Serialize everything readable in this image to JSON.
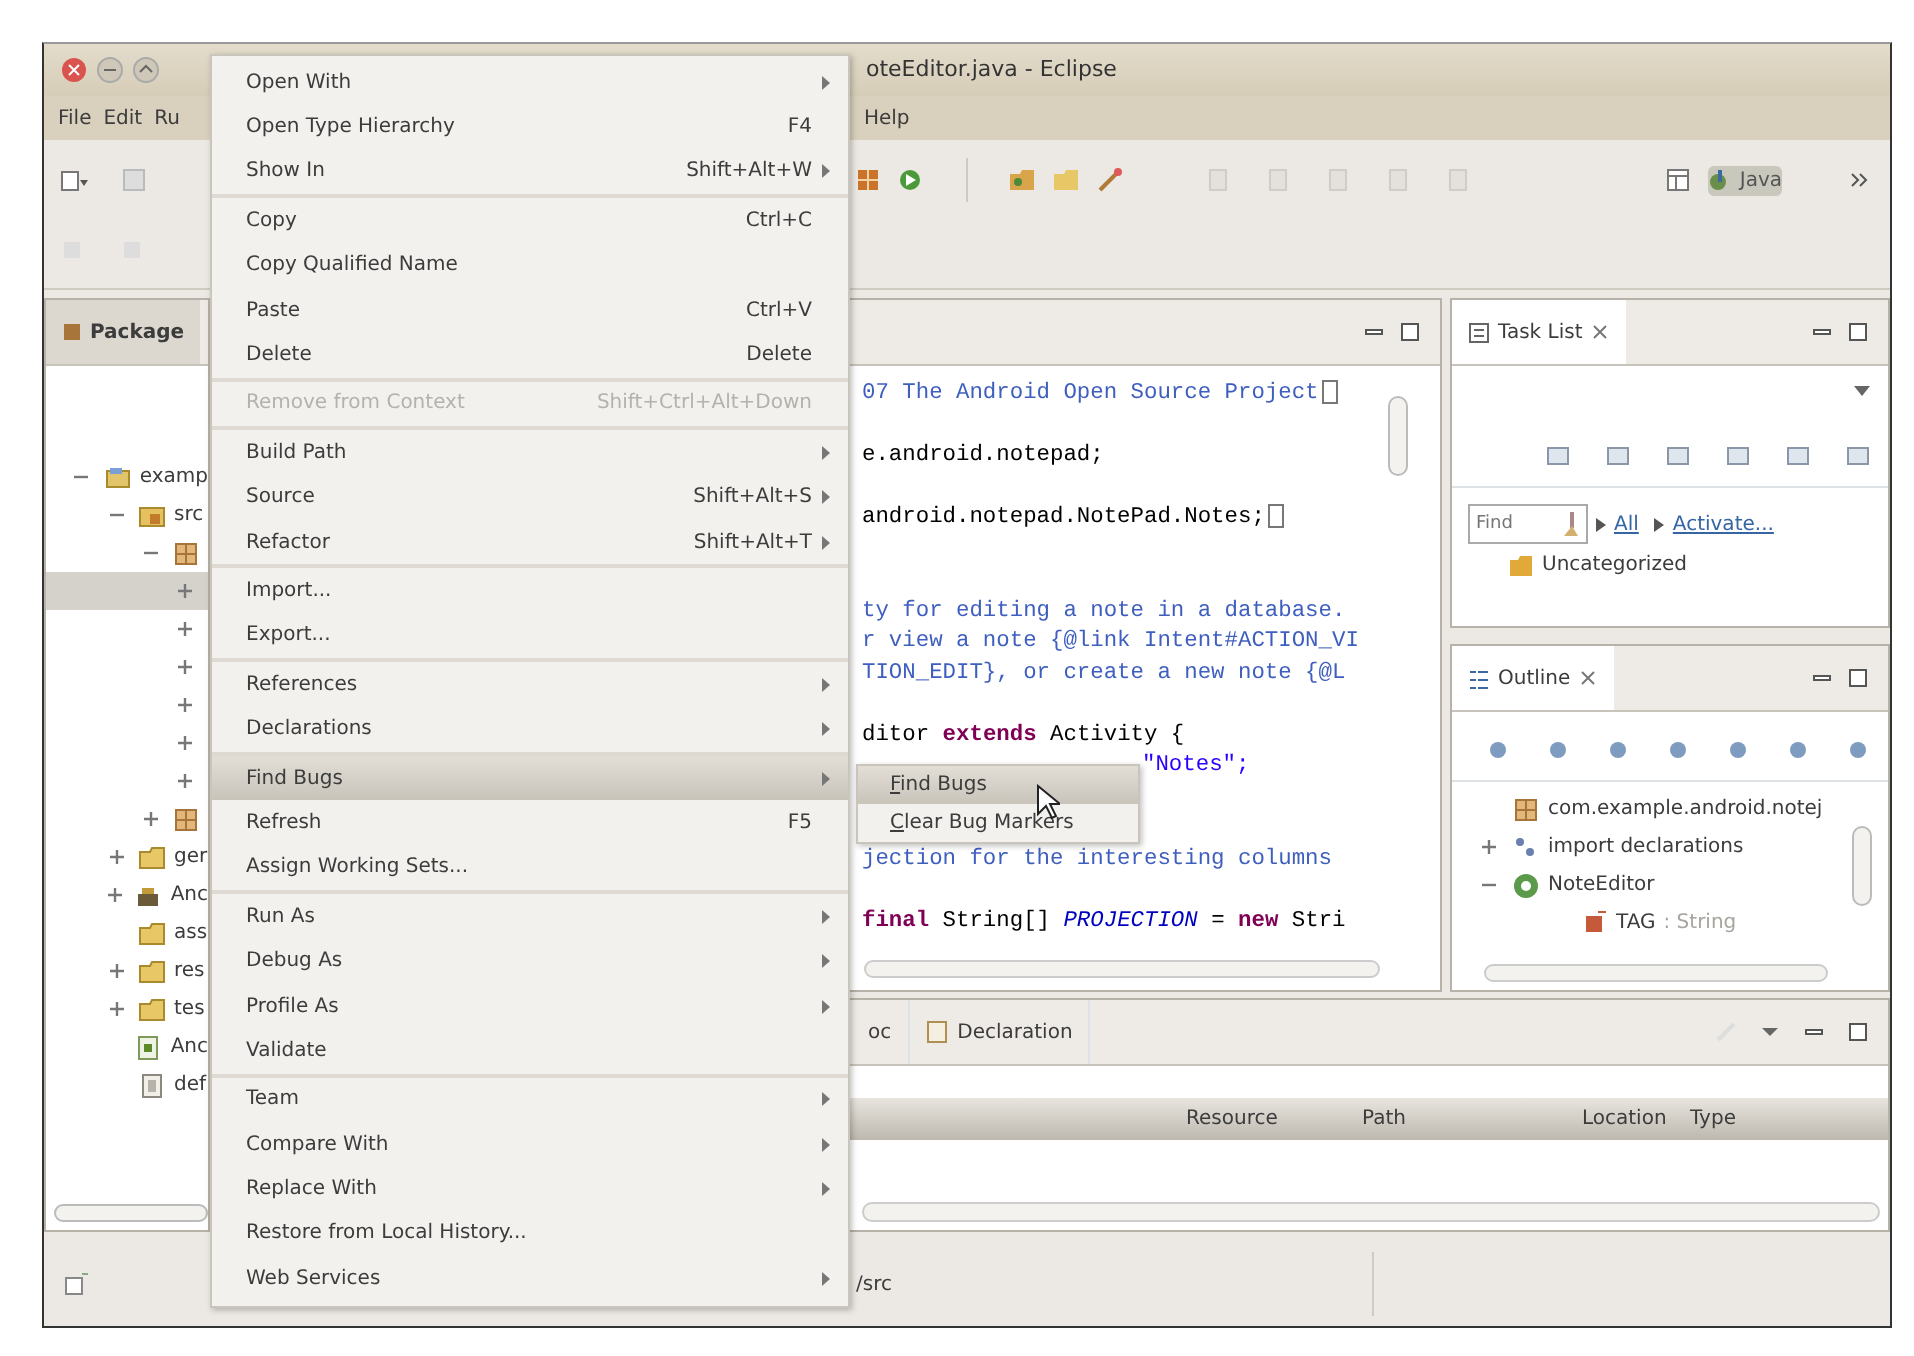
{
  "window": {
    "title": "oteEditor.java - Eclipse"
  },
  "menu_bar": {
    "left_items": [
      "File",
      "Edit",
      "Ru"
    ],
    "right_items": [
      "Help"
    ]
  },
  "toolbar": {
    "perspective": {
      "label": "Java",
      "selected": true
    }
  },
  "package_explorer": {
    "tab": "Package",
    "tree": [
      {
        "label": "examp",
        "kind": "project",
        "expanded": true,
        "selected": false,
        "children": [
          {
            "label": "src",
            "kind": "source-folder",
            "expanded": true,
            "selected": false,
            "children": [
              {
                "kind": "package",
                "expanded": true,
                "selected": false,
                "children": [
                  {
                    "expanded": false,
                    "selected": true
                  },
                  {
                    "expanded": false,
                    "selected": false
                  },
                  {
                    "expanded": false,
                    "selected": false
                  },
                  {
                    "expanded": false,
                    "selected": false
                  },
                  {
                    "expanded": false,
                    "selected": false
                  },
                  {
                    "expanded": false,
                    "selected": false
                  }
                ]
              },
              {
                "kind": "package",
                "expanded": false,
                "selected": false
              }
            ]
          },
          {
            "label": "ger",
            "kind": "folder",
            "expanded": false,
            "selected": false
          },
          {
            "label": "Anc",
            "kind": "library",
            "expanded": false,
            "selected": false
          },
          {
            "label": "ass",
            "kind": "folder",
            "selected": false
          },
          {
            "label": "res",
            "kind": "folder",
            "expanded": false,
            "selected": false
          },
          {
            "label": "tes",
            "kind": "folder",
            "expanded": false,
            "selected": false
          },
          {
            "label": "Anc",
            "kind": "manifest",
            "selected": false
          },
          {
            "label": "def",
            "kind": "file",
            "selected": false
          }
        ]
      }
    ]
  },
  "editor": {
    "lines": [
      {
        "kind": "comment",
        "text": "07 The Android Open Source Project",
        "folded": true
      },
      {
        "kind": "blank"
      },
      {
        "kind": "code",
        "text": "e.android.notepad;"
      },
      {
        "kind": "blank"
      },
      {
        "kind": "code",
        "text": "android.notepad.NotePad.Notes;",
        "folded": true
      },
      {
        "kind": "blank"
      },
      {
        "kind": "blank"
      },
      {
        "kind": "comment",
        "text": "ty for editing a note in a database."
      },
      {
        "kind": "comment",
        "text": "r view a note {@link Intent#ACTION_VI"
      },
      {
        "kind": "comment",
        "text": "TION_EDIT}, or create a new note {@L"
      },
      {
        "kind": "blank"
      },
      {
        "kind": "code",
        "text": "ditor **extends** Activity {"
      },
      {
        "kind": "string-tail",
        "text": "\"Notes\";"
      },
      {
        "kind": "blank"
      },
      {
        "kind": "blank"
      },
      {
        "kind": "comment",
        "text": "jection for the interesting columns"
      },
      {
        "kind": "blank"
      },
      {
        "kind": "code",
        "text": "**final** String[] *PROJECTION* = **new** Stri"
      }
    ]
  },
  "task_list": {
    "tab": "Task List",
    "find_placeholder": "Find",
    "filters": [
      "All",
      "Activate..."
    ],
    "items": [
      "Uncategorized"
    ]
  },
  "outline": {
    "tab": "Outline",
    "tree": [
      {
        "label": "com.example.android.notej",
        "kind": "package"
      },
      {
        "label": "import declarations",
        "kind": "imports",
        "expanded": false
      },
      {
        "label": "NoteEditor",
        "kind": "class",
        "expanded": true,
        "children": [
          {
            "label": "TAG",
            "type": ": String",
            "kind": "field"
          }
        ]
      }
    ]
  },
  "bottom_panel": {
    "tabs": [
      {
        "label": "oc",
        "selected": false
      },
      {
        "label": "Declaration",
        "selected": false
      }
    ],
    "columns": [
      "Resource",
      "Path",
      "Location",
      "Type"
    ]
  },
  "status_bar": {
    "text": "/src"
  },
  "context_menu": {
    "items": [
      {
        "label": "Open With",
        "submenu": true,
        "disabled": false,
        "selected": false,
        "separator_after": false
      },
      {
        "label": "Open Type Hierarchy",
        "shortcut": "F4",
        "submenu": false,
        "disabled": false,
        "selected": false,
        "separator_after": false
      },
      {
        "label": "Show In",
        "shortcut": "Shift+Alt+W",
        "submenu": true,
        "disabled": false,
        "selected": false,
        "separator_after": true
      },
      {
        "label": "Copy",
        "shortcut": "Ctrl+C",
        "submenu": false,
        "disabled": false,
        "selected": false,
        "separator_after": false
      },
      {
        "label": "Copy Qualified Name",
        "submenu": false,
        "disabled": false,
        "selected": false,
        "separator_after": false
      },
      {
        "label": "Paste",
        "shortcut": "Ctrl+V",
        "submenu": false,
        "disabled": false,
        "selected": false,
        "separator_after": false
      },
      {
        "label": "Delete",
        "shortcut": "Delete",
        "submenu": false,
        "disabled": false,
        "selected": false,
        "separator_after": true
      },
      {
        "label": "Remove from Context",
        "shortcut": "Shift+Ctrl+Alt+Down",
        "submenu": false,
        "disabled": true,
        "selected": false,
        "separator_after": true
      },
      {
        "label": "Build Path",
        "submenu": true,
        "disabled": false,
        "selected": false,
        "separator_after": false
      },
      {
        "label": "Source",
        "shortcut": "Shift+Alt+S",
        "submenu": true,
        "disabled": false,
        "selected": false,
        "separator_after": false
      },
      {
        "label": "Refactor",
        "shortcut": "Shift+Alt+T",
        "submenu": true,
        "disabled": false,
        "selected": false,
        "separator_after": true
      },
      {
        "label": "Import...",
        "submenu": false,
        "disabled": false,
        "selected": false,
        "separator_after": false
      },
      {
        "label": "Export...",
        "submenu": false,
        "disabled": false,
        "selected": false,
        "separator_after": true
      },
      {
        "label": "References",
        "submenu": true,
        "disabled": false,
        "selected": false,
        "separator_after": false
      },
      {
        "label": "Declarations",
        "submenu": true,
        "disabled": false,
        "selected": false,
        "separator_after": true
      },
      {
        "label": "Find Bugs",
        "submenu": true,
        "disabled": false,
        "selected": true,
        "separator_after": false
      },
      {
        "label": "Refresh",
        "shortcut": "F5",
        "submenu": false,
        "disabled": false,
        "selected": false,
        "separator_after": false
      },
      {
        "label": "Assign Working Sets...",
        "submenu": false,
        "disabled": false,
        "selected": false,
        "separator_after": true
      },
      {
        "label": "Run As",
        "submenu": true,
        "disabled": false,
        "selected": false,
        "separator_after": false
      },
      {
        "label": "Debug As",
        "submenu": true,
        "disabled": false,
        "selected": false,
        "separator_after": false
      },
      {
        "label": "Profile As",
        "submenu": true,
        "disabled": false,
        "selected": false,
        "separator_after": false
      },
      {
        "label": "Validate",
        "submenu": false,
        "disabled": false,
        "selected": false,
        "separator_after": true
      },
      {
        "label": "Team",
        "submenu": true,
        "disabled": false,
        "selected": false,
        "separator_after": false
      },
      {
        "label": "Compare With",
        "submenu": true,
        "disabled": false,
        "selected": false,
        "separator_after": false
      },
      {
        "label": "Replace With",
        "submenu": true,
        "disabled": false,
        "selected": false,
        "separator_after": false
      },
      {
        "label": "Restore from Local History...",
        "submenu": false,
        "disabled": false,
        "selected": false,
        "separator_after": false
      },
      {
        "label": "Web Services",
        "submenu": true,
        "disabled": false,
        "selected": false,
        "separator_after": false
      }
    ]
  },
  "submenu": {
    "items": [
      {
        "label": "Find Bugs",
        "selected": true,
        "mnemonic": true
      },
      {
        "label": "Clear Bug Markers",
        "selected": false,
        "mnemonic": true
      }
    ]
  }
}
